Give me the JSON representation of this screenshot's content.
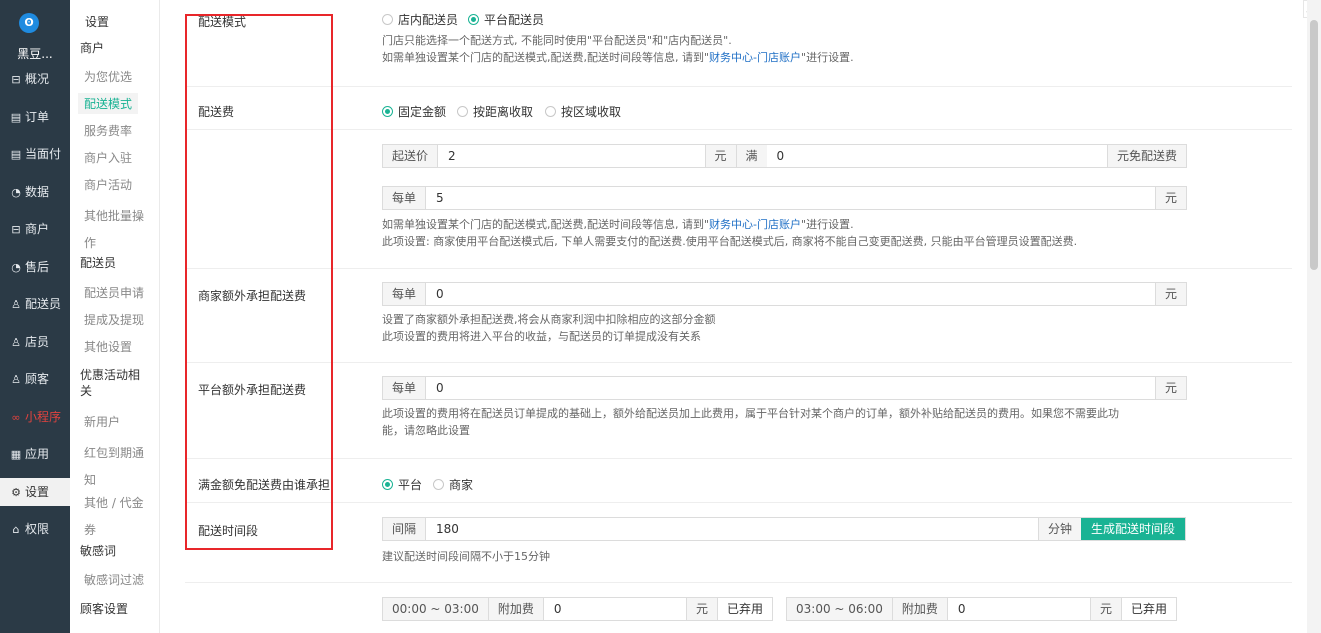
{
  "nav": {
    "brand": "黑豆...",
    "items": [
      {
        "icon": "⊟",
        "label": "概况"
      },
      {
        "icon": "▤",
        "label": "订单"
      },
      {
        "icon": "▤",
        "label": "当面付"
      },
      {
        "icon": "◔",
        "label": "数据"
      },
      {
        "icon": "⊟",
        "label": "商户"
      },
      {
        "icon": "◔",
        "label": "售后"
      },
      {
        "icon": "♙",
        "label": "配送员"
      },
      {
        "icon": "♙",
        "label": "店员"
      },
      {
        "icon": "♙",
        "label": "顾客"
      },
      {
        "icon": "∞",
        "label": "小程序"
      },
      {
        "icon": "▦",
        "label": "应用"
      },
      {
        "icon": "⚙",
        "label": "设置"
      },
      {
        "icon": "⌂",
        "label": "权限"
      }
    ]
  },
  "submenu": {
    "title": "设置",
    "groups": [
      "商户",
      "配送员",
      "优惠活动相关",
      "敏感词",
      "顾客设置"
    ],
    "links": [
      "为您优选",
      "配送模式",
      "服务费率",
      "商户入驻",
      "商户活动",
      "其他批量操作",
      "配送员申请",
      "提成及提现",
      "其他设置",
      "新用户",
      "红包到期通知",
      "其他 / 代金券",
      "敏感词过滤"
    ]
  },
  "form": {
    "delivery_mode": {
      "label": "配送模式",
      "options": [
        "店内配送员",
        "平台配送员"
      ],
      "selected": "平台配送员",
      "help1": "门店只能选择一个配送方式, 不能同时使用\"平台配送员\"和\"店内配送员\".",
      "help2_a": "如需单独设置某个门店的配送模式,配送费,配送时间段等信息, 请到\"",
      "help2_link": "财务中心-门店账户",
      "help2_b": "\"进行设置."
    },
    "delivery_fee": {
      "label": "配送费",
      "options": [
        "固定金额",
        "按距离收取",
        "按区域收取"
      ],
      "selected": "固定金额",
      "start_price_label": "起送价",
      "start_price": "2",
      "yuan": "元",
      "full_label": "满",
      "full_value": "0",
      "free_label": "元免配送费",
      "per_order_label": "每单",
      "per_order_value": "5",
      "help1_a": "如需单独设置某个门店的配送模式,配送费,配送时间段等信息, 请到\"",
      "help1_link": "财务中心-门店账户",
      "help1_b": "\"进行设置.",
      "help2": "此项设置: 商家使用平台配送模式后, 下单人需要支付的配送费.使用平台配送模式后, 商家将不能自己变更配送费, 只能由平台管理员设置配送费."
    },
    "merchant_extra": {
      "label": "商家额外承担配送费",
      "per_order_label": "每单",
      "value": "0",
      "unit": "元",
      "help1": "设置了商家额外承担配送费,将会从商家利润中扣除相应的这部分金额",
      "help2": "此项设置的费用将进入平台的收益，与配送员的订单提成没有关系"
    },
    "platform_extra": {
      "label": "平台额外承担配送费",
      "per_order_label": "每单",
      "value": "0",
      "unit": "元",
      "help1": "此项设置的费用将在配送员订单提成的基础上，额外给配送员加上此费用，属于平台针对某个商户的订单，额外补贴给配送员的费用。如果您不需要此功",
      "help2": "能，请忽略此设置"
    },
    "free_bearer": {
      "label": "满金额免配送费由谁承担",
      "options": [
        "平台",
        "商家"
      ],
      "selected": "平台"
    },
    "time_slot": {
      "label": "配送时间段",
      "interval_label": "间隔",
      "interval_value": "180",
      "unit": "分钟",
      "generate_button": "生成配送时间段",
      "help": "建议配送时间段间隔不小于15分钟"
    },
    "slots": [
      {
        "range": "00:00 ~ 03:00",
        "surcharge_label": "附加费",
        "value": "0",
        "unit": "元",
        "status": "已弃用"
      },
      {
        "range": "03:00 ~ 06:00",
        "surcharge_label": "附加费",
        "value": "0",
        "unit": "元",
        "status": "已弃用"
      }
    ]
  },
  "colors": {
    "accent": "#1ab394",
    "nav_bg": "#2b3a46",
    "highlight_box": "#e8262a",
    "link": "#1f6fc5"
  }
}
